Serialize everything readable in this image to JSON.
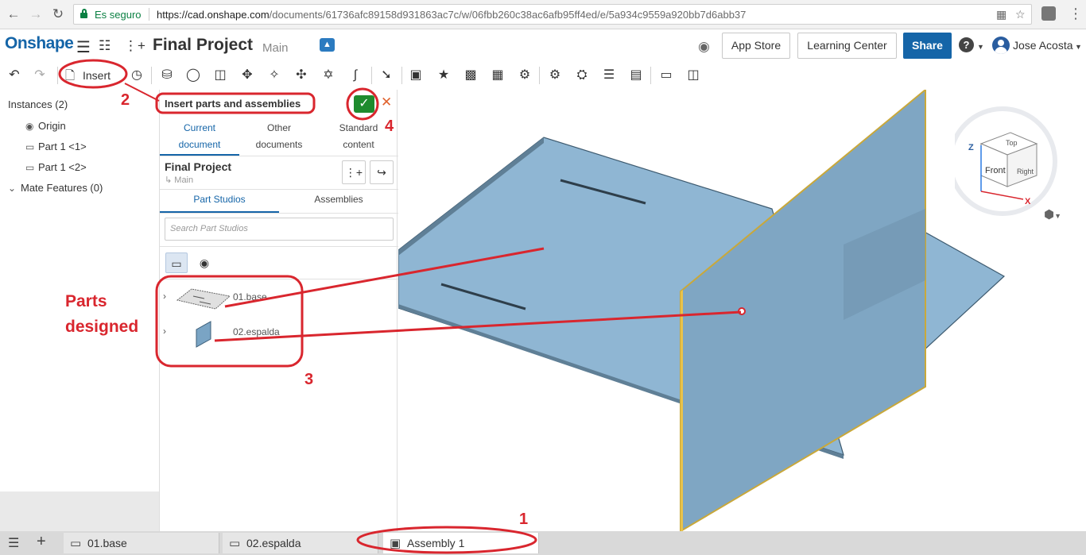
{
  "browser": {
    "secure_label": "Es seguro",
    "url_host": "https://cad.onshape.com",
    "url_path": "/documents/61736afc89158d931863ac7c/w/06fbb260c38ac6afb95ff4ed/e/5a934c9559a920bb7d6abb37"
  },
  "header": {
    "logo": "Onshape",
    "doc_title": "Final Project",
    "doc_branch": "Main",
    "app_store": "App Store",
    "learning_center": "Learning Center",
    "share": "Share",
    "user_name": "Jose Acosta"
  },
  "toolbar": {
    "insert_label": "Insert"
  },
  "instances": {
    "title": "Instances (2)",
    "items": [
      {
        "label": "Origin",
        "icon": "origin-icon"
      },
      {
        "label": "Part 1 <1>",
        "icon": "part-icon"
      },
      {
        "label": "Part 1 <2>",
        "icon": "part-icon"
      }
    ],
    "mate_features": "Mate Features (0)"
  },
  "dialog": {
    "title": "Insert parts and assemblies",
    "tabs": [
      {
        "label_line1": "Current",
        "label_line2": "document",
        "active": true
      },
      {
        "label_line1": "Other",
        "label_line2": "documents",
        "active": false
      },
      {
        "label_line1": "Standard",
        "label_line2": "content",
        "active": false
      }
    ],
    "project_name": "Final Project",
    "project_branch": "Main",
    "subtabs": [
      {
        "label": "Part Studios",
        "active": true
      },
      {
        "label": "Assemblies",
        "active": false
      }
    ],
    "search_placeholder": "Search Part Studios",
    "parts": [
      {
        "name": "01.base"
      },
      {
        "name": "02.espalda"
      }
    ]
  },
  "bottom_tabs": [
    {
      "label": "01.base",
      "active": false
    },
    {
      "label": "02.espalda",
      "active": false
    },
    {
      "label": "Assembly 1",
      "active": true
    }
  ],
  "view_cube": {
    "top": "Top",
    "front": "Front",
    "right": "Right",
    "axis_x": "X",
    "axis_z": "Z"
  },
  "annotations": {
    "n1": "1",
    "n2": "2",
    "n3": "3",
    "n4": "4",
    "parts_label_line1": "Parts",
    "parts_label_line2": "designed"
  },
  "colors": {
    "brand": "#1565a8",
    "annotation": "#d9262e",
    "part_fill": "#8fb6d3",
    "ok_green": "#1e8b2e"
  }
}
